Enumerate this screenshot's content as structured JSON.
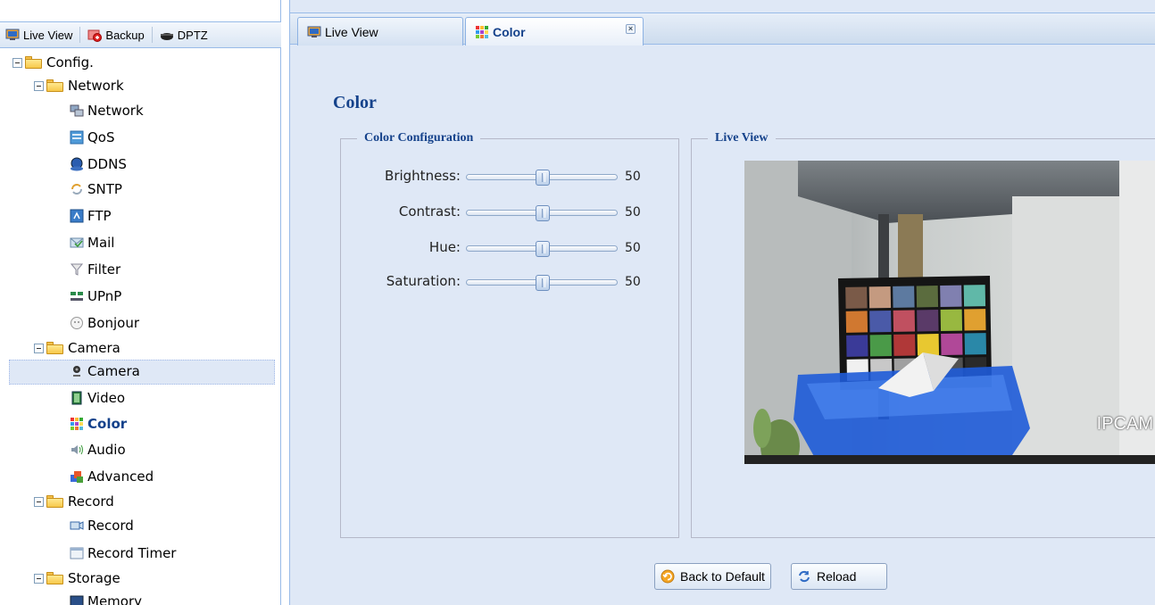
{
  "left_toolbar": {
    "buttons": [
      {
        "label": "Live View",
        "icon": "monitor-icon"
      },
      {
        "label": "Backup",
        "icon": "backup-icon"
      },
      {
        "label": "DPTZ",
        "icon": "dome-camera-icon"
      }
    ]
  },
  "tree": {
    "config": {
      "label": "Config."
    },
    "network": {
      "label": "Network",
      "items": [
        {
          "label": "Network",
          "icon": "network-icon"
        },
        {
          "label": "QoS",
          "icon": "qos-icon"
        },
        {
          "label": "DDNS",
          "icon": "ddns-icon"
        },
        {
          "label": "SNTP",
          "icon": "sntp-icon"
        },
        {
          "label": "FTP",
          "icon": "ftp-icon"
        },
        {
          "label": "Mail",
          "icon": "mail-icon"
        },
        {
          "label": "Filter",
          "icon": "filter-icon"
        },
        {
          "label": "UPnP",
          "icon": "upnp-icon"
        },
        {
          "label": "Bonjour",
          "icon": "bonjour-icon"
        }
      ]
    },
    "camera": {
      "label": "Camera",
      "items": [
        {
          "label": "Camera",
          "icon": "camera-icon"
        },
        {
          "label": "Video",
          "icon": "video-icon"
        },
        {
          "label": "Color",
          "icon": "color-icon",
          "selected": true
        },
        {
          "label": "Audio",
          "icon": "audio-icon"
        },
        {
          "label": "Advanced",
          "icon": "advanced-icon"
        }
      ]
    },
    "record": {
      "label": "Record",
      "items": [
        {
          "label": "Record",
          "icon": "record-icon"
        },
        {
          "label": "Record Timer",
          "icon": "record-timer-icon"
        }
      ]
    },
    "storage": {
      "label": "Storage",
      "items": [
        {
          "label": "Memory",
          "icon": "memory-icon"
        }
      ]
    }
  },
  "tabs": [
    {
      "label": "Live View",
      "icon": "monitor-icon",
      "active": false
    },
    {
      "label": "Color",
      "icon": "color-icon",
      "active": true,
      "closable": true
    }
  ],
  "page": {
    "title": "Color",
    "color_config": {
      "legend": "Color Configuration",
      "sliders": [
        {
          "label": "Brightness:",
          "value": 50,
          "min": 0,
          "max": 100
        },
        {
          "label": "Contrast:",
          "value": 50,
          "min": 0,
          "max": 100
        },
        {
          "label": "Hue:",
          "value": 50,
          "min": 0,
          "max": 100
        },
        {
          "label": "Saturation:",
          "value": 50,
          "min": 0,
          "max": 100
        }
      ]
    },
    "live_view": {
      "legend": "Live View",
      "overlay_text": "IPCAM"
    },
    "buttons": {
      "back_to_default": "Back to Default",
      "reload": "Reload"
    }
  },
  "colors": {
    "accent": "#15428b",
    "panel_bg": "#dfe8f6",
    "border": "#99bbe8"
  }
}
